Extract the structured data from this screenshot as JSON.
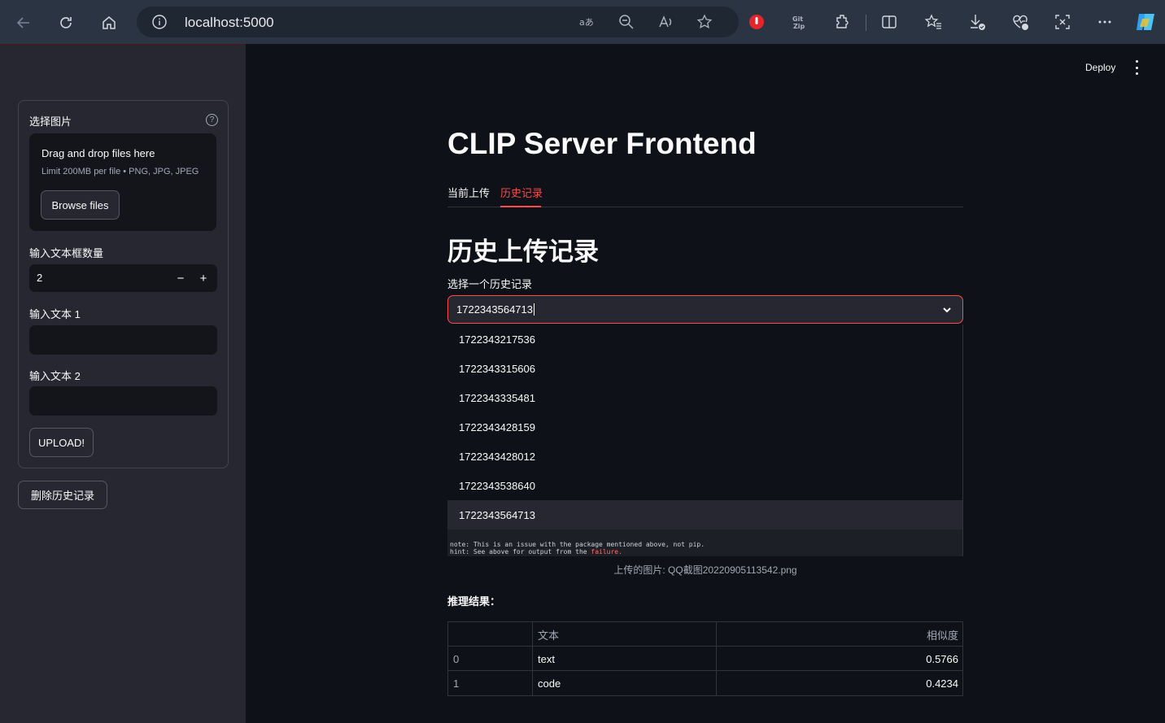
{
  "browser": {
    "url": "localhost:5000"
  },
  "sidebar": {
    "uploader_label": "选择图片",
    "dropzone_title": "Drag and drop files here",
    "dropzone_limit": "Limit 200MB per file • PNG, JPG, JPEG",
    "browse_label": "Browse files",
    "count_label": "输入文本框数量",
    "count_value": "2",
    "minus_label": "−",
    "plus_label": "+",
    "text1_label": "输入文本 1",
    "text2_label": "输入文本 2",
    "upload_label": "UPLOAD!",
    "delete_label": "删除历史记录"
  },
  "main": {
    "deploy_label": "Deploy",
    "title": "CLIP Server Frontend",
    "tabs": [
      {
        "label": "当前上传"
      },
      {
        "label": "历史记录"
      }
    ],
    "history_heading": "历史上传记录",
    "select_label": "选择一个历史记录",
    "select_value": "1722343564713",
    "options": [
      {
        "label": "1722343217536"
      },
      {
        "label": "1722343315606"
      },
      {
        "label": "1722343335481"
      },
      {
        "label": "1722343428159"
      },
      {
        "label": "1722343428012"
      },
      {
        "label": "1722343538640"
      },
      {
        "label": "1722343564713"
      }
    ],
    "image_text": {
      "line1": "note: This is an issue with the package mentioned above, not pip.",
      "line2_prefix": "hint: See above for output from the ",
      "line2_red": "failure."
    },
    "caption": "上传的图片: QQ截图20220905113542.png",
    "result_label": "推理结果：",
    "table": {
      "headers": [
        "",
        "文本",
        "相似度"
      ],
      "rows": [
        [
          "0",
          "text",
          "0.5766"
        ],
        [
          "1",
          "code",
          "0.4234"
        ]
      ]
    }
  },
  "colors": {
    "accent": "#ff4b4b",
    "background": "#0e1117",
    "sidebar": "#262730"
  }
}
